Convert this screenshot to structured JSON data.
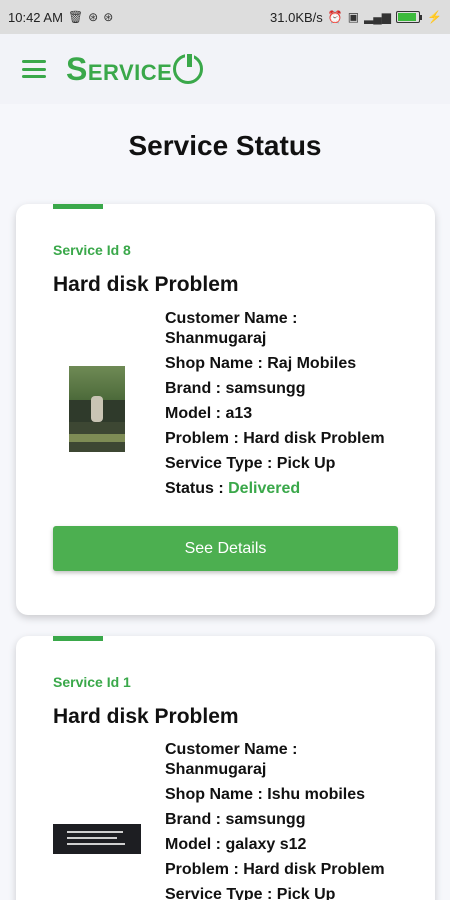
{
  "status_bar": {
    "time": "10:42 AM",
    "network_speed": "31.0KB/s",
    "left_icons": [
      "trash-icon",
      "sync-icon",
      "sync-icon"
    ],
    "right_icons": [
      "alarm-icon",
      "sim-icon",
      "signal-icon",
      "battery-icon",
      "charging-icon"
    ],
    "battery_level": 0.9,
    "accent_color": "#3cba3c"
  },
  "app_bar": {
    "logo_text": "Service",
    "brand_color": "#3aa84a"
  },
  "page": {
    "title": "Service Status"
  },
  "labels": {
    "customer_name": "Customer Name :",
    "shop_name": "Shop Name :",
    "brand": "Brand :",
    "model": "Model :",
    "problem": "Problem :",
    "service_type": "Service Type :",
    "status": "Status :"
  },
  "services": [
    {
      "service_id": "Service Id 8",
      "title": "Hard disk Problem",
      "customer_name": "Shanmugaraj",
      "shop_name": "Raj Mobiles",
      "brand": "samsungg",
      "model": "a13",
      "problem": "Hard disk Problem",
      "service_type": "Pick Up",
      "status": "Delivered",
      "status_color": "#3aa84a",
      "button_label": "See Details"
    },
    {
      "service_id": "Service Id 1",
      "title": "Hard disk Problem",
      "customer_name": "Shanmugaraj",
      "shop_name": "Ishu mobiles",
      "brand": "samsungg",
      "model": "galaxy s12",
      "problem": "Hard disk Problem",
      "service_type": "Pick Up"
    }
  ]
}
